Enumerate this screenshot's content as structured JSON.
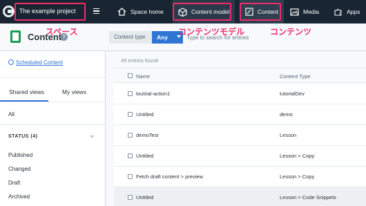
{
  "topbar": {
    "space_name": "The example project",
    "nav": [
      {
        "label": "Space home",
        "icon": "home-icon"
      },
      {
        "label": "Content model",
        "icon": "cube-icon"
      },
      {
        "label": "Content",
        "icon": "content-edit-icon"
      },
      {
        "label": "Media",
        "icon": "media-icon"
      },
      {
        "label": "Apps",
        "icon": "puzzle-icon"
      }
    ]
  },
  "annotations": {
    "space": "スペース",
    "content_model": "コンテンツモデル",
    "content": "コンテンツ",
    "color": "#ee2d6a"
  },
  "header": {
    "title": "Content",
    "help_glyph": "?"
  },
  "filter": {
    "content_type_label": "Content type",
    "content_type_value": "Any",
    "search_placeholder": "Type to search for entries"
  },
  "sidebar": {
    "scheduled_link": "Scheduled Content",
    "tabs": [
      {
        "label": "Shared views"
      },
      {
        "label": "My views"
      }
    ],
    "all_label": "All",
    "status_heading": "STATUS (4)",
    "status_items": [
      "Published",
      "Changed",
      "Draft",
      "Archived"
    ]
  },
  "list": {
    "entries_found": "49 entries found",
    "columns": [
      "Name",
      "Content Type"
    ],
    "rows": [
      {
        "name": "toutrial-action1",
        "type": "tutorialDev"
      },
      {
        "name": "Untitled",
        "type": "demo"
      },
      {
        "name": "demoTest",
        "type": "Lesson"
      },
      {
        "name": "Untitled",
        "type": "Lesson > Copy"
      },
      {
        "name": "Fetch draft content > preview",
        "type": "Lesson > Copy"
      },
      {
        "name": "Untitled",
        "type": "Lesson > Code Snippets"
      }
    ]
  },
  "colors": {
    "topbar_bg": "#192532",
    "accent_blue": "#2e75d4",
    "content_icon_green": "#1a9b53"
  }
}
